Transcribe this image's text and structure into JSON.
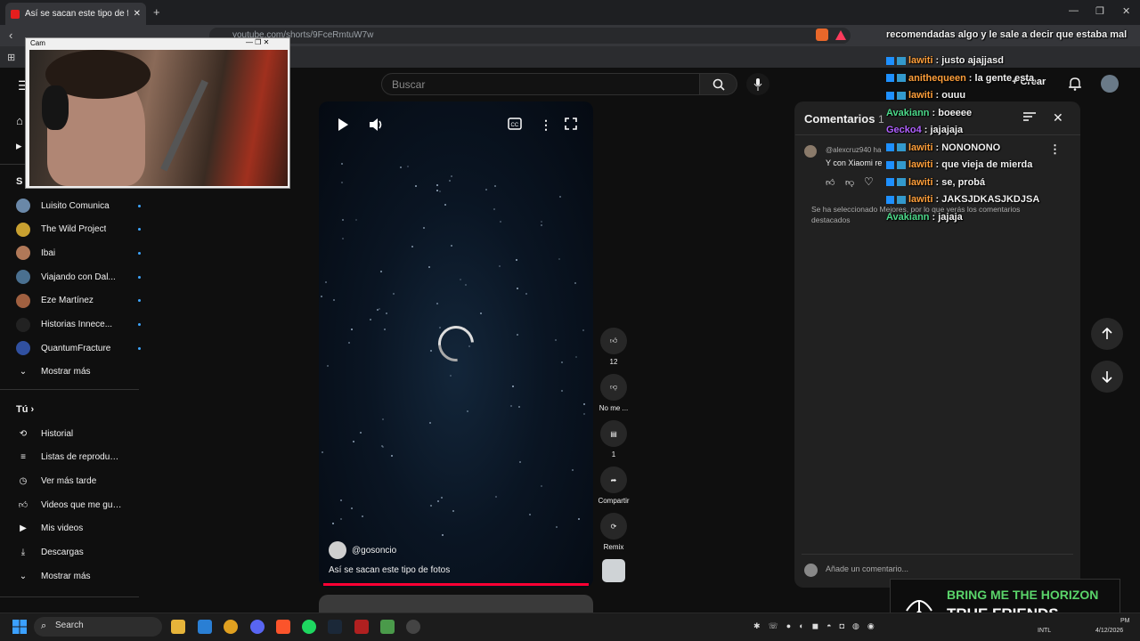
{
  "browser": {
    "tab_title": "Así se sacan este tipo de fotos -",
    "url": "youtube.com/shorts/9FceRmtuW7w"
  },
  "cam": {
    "title": "Cam"
  },
  "youtube": {
    "search_placeholder": "Buscar",
    "crear": "Crear",
    "subscriptions": [
      {
        "name": "Luisito Comunica",
        "color": "#6a88a8"
      },
      {
        "name": "The Wild Project",
        "color": "#c8a030"
      },
      {
        "name": "Ibai",
        "color": "#b07858"
      },
      {
        "name": "Viajando con Dal...",
        "color": "#4a7090"
      },
      {
        "name": "Eze Martínez",
        "color": "#a06040"
      },
      {
        "name": "Historias Innece...",
        "color": "#222"
      },
      {
        "name": "QuantumFracture",
        "color": "#3050a0"
      }
    ],
    "mostrar_mas": "Mostrar más",
    "tu_label": "Tú",
    "you_items": [
      "Historial",
      "Listas de reproducc...",
      "Ver más tarde",
      "Videos que me gus...",
      "Mis videos",
      "Descargas",
      "Mostrar más"
    ],
    "video": {
      "channel": "@gosoncio",
      "title": "Así se sacan este tipo de fotos"
    },
    "actions": {
      "likes": "12",
      "dislike": "No me ...",
      "comments": "1",
      "share": "Compartir",
      "remix": "Remix"
    },
    "comments_panel": {
      "title": "Comentarios",
      "count": "1",
      "user": "@alexcruz940",
      "user_suffix": "ha",
      "text": "Y con Xiaomi re",
      "note": "Se ha seleccionado Mejores, por lo que verás los comentarios destacados",
      "add_placeholder": "Añade un comentario..."
    }
  },
  "chat": {
    "top_line": "recomendadas algo y le sale a decir que estaba mal",
    "messages": [
      {
        "user": "lawiti",
        "text": ": justo ajajjasd",
        "color": "#ff9f3a"
      },
      {
        "user": "anithequeen",
        "text": ": la gente esta",
        "color": "#ff9f3a"
      },
      {
        "user": "lawiti",
        "text": ": ouuu",
        "color": "#ff9f3a"
      },
      {
        "user": "Avakiann",
        "text": ": boeeee",
        "color": "#4cd98a"
      },
      {
        "user": "Gecko4",
        "text": ": jajajaja",
        "color": "#b060ff"
      },
      {
        "user": "lawiti",
        "text": ": NONONONO",
        "color": "#ff9f3a"
      },
      {
        "user": "lawiti",
        "text": ": que vieja de mierda",
        "color": "#ff9f3a"
      },
      {
        "user": "lawiti",
        "text": ": se, probá",
        "color": "#ff9f3a"
      },
      {
        "user": "lawiti",
        "text": ": JAKSJDKASJKDJSA",
        "color": "#ff9f3a"
      },
      {
        "user": "Avakiann",
        "text": ": jajaja",
        "color": "#4cd98a"
      }
    ]
  },
  "taskbar": {
    "search": "Search",
    "lang": "INTL",
    "time": "PM",
    "date": "4/12/2026"
  },
  "music": {
    "line1": "BRING ME THE HORIZON",
    "line2": "TRUE FRIENDS"
  },
  "colors": {
    "accent": "#ff0033",
    "link": "#3ea6ff"
  }
}
